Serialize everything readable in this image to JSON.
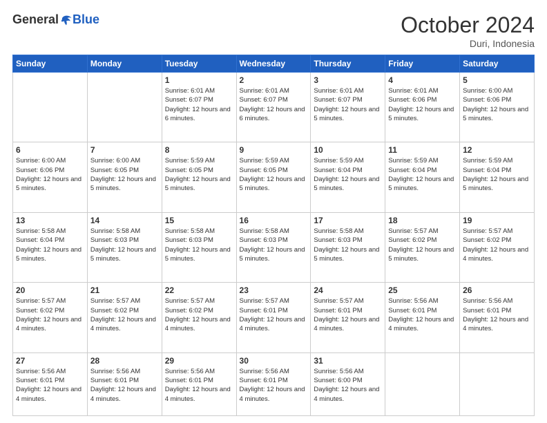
{
  "logo": {
    "general": "General",
    "blue": "Blue"
  },
  "header": {
    "month": "October 2024",
    "location": "Duri, Indonesia"
  },
  "weekdays": [
    "Sunday",
    "Monday",
    "Tuesday",
    "Wednesday",
    "Thursday",
    "Friday",
    "Saturday"
  ],
  "weeks": [
    [
      {
        "day": "",
        "info": ""
      },
      {
        "day": "",
        "info": ""
      },
      {
        "day": "1",
        "info": "Sunrise: 6:01 AM\nSunset: 6:07 PM\nDaylight: 12 hours and 6 minutes."
      },
      {
        "day": "2",
        "info": "Sunrise: 6:01 AM\nSunset: 6:07 PM\nDaylight: 12 hours and 6 minutes."
      },
      {
        "day": "3",
        "info": "Sunrise: 6:01 AM\nSunset: 6:07 PM\nDaylight: 12 hours and 5 minutes."
      },
      {
        "day": "4",
        "info": "Sunrise: 6:01 AM\nSunset: 6:06 PM\nDaylight: 12 hours and 5 minutes."
      },
      {
        "day": "5",
        "info": "Sunrise: 6:00 AM\nSunset: 6:06 PM\nDaylight: 12 hours and 5 minutes."
      }
    ],
    [
      {
        "day": "6",
        "info": "Sunrise: 6:00 AM\nSunset: 6:06 PM\nDaylight: 12 hours and 5 minutes."
      },
      {
        "day": "7",
        "info": "Sunrise: 6:00 AM\nSunset: 6:05 PM\nDaylight: 12 hours and 5 minutes."
      },
      {
        "day": "8",
        "info": "Sunrise: 5:59 AM\nSunset: 6:05 PM\nDaylight: 12 hours and 5 minutes."
      },
      {
        "day": "9",
        "info": "Sunrise: 5:59 AM\nSunset: 6:05 PM\nDaylight: 12 hours and 5 minutes."
      },
      {
        "day": "10",
        "info": "Sunrise: 5:59 AM\nSunset: 6:04 PM\nDaylight: 12 hours and 5 minutes."
      },
      {
        "day": "11",
        "info": "Sunrise: 5:59 AM\nSunset: 6:04 PM\nDaylight: 12 hours and 5 minutes."
      },
      {
        "day": "12",
        "info": "Sunrise: 5:59 AM\nSunset: 6:04 PM\nDaylight: 12 hours and 5 minutes."
      }
    ],
    [
      {
        "day": "13",
        "info": "Sunrise: 5:58 AM\nSunset: 6:04 PM\nDaylight: 12 hours and 5 minutes."
      },
      {
        "day": "14",
        "info": "Sunrise: 5:58 AM\nSunset: 6:03 PM\nDaylight: 12 hours and 5 minutes."
      },
      {
        "day": "15",
        "info": "Sunrise: 5:58 AM\nSunset: 6:03 PM\nDaylight: 12 hours and 5 minutes."
      },
      {
        "day": "16",
        "info": "Sunrise: 5:58 AM\nSunset: 6:03 PM\nDaylight: 12 hours and 5 minutes."
      },
      {
        "day": "17",
        "info": "Sunrise: 5:58 AM\nSunset: 6:03 PM\nDaylight: 12 hours and 5 minutes."
      },
      {
        "day": "18",
        "info": "Sunrise: 5:57 AM\nSunset: 6:02 PM\nDaylight: 12 hours and 5 minutes."
      },
      {
        "day": "19",
        "info": "Sunrise: 5:57 AM\nSunset: 6:02 PM\nDaylight: 12 hours and 4 minutes."
      }
    ],
    [
      {
        "day": "20",
        "info": "Sunrise: 5:57 AM\nSunset: 6:02 PM\nDaylight: 12 hours and 4 minutes."
      },
      {
        "day": "21",
        "info": "Sunrise: 5:57 AM\nSunset: 6:02 PM\nDaylight: 12 hours and 4 minutes."
      },
      {
        "day": "22",
        "info": "Sunrise: 5:57 AM\nSunset: 6:02 PM\nDaylight: 12 hours and 4 minutes."
      },
      {
        "day": "23",
        "info": "Sunrise: 5:57 AM\nSunset: 6:01 PM\nDaylight: 12 hours and 4 minutes."
      },
      {
        "day": "24",
        "info": "Sunrise: 5:57 AM\nSunset: 6:01 PM\nDaylight: 12 hours and 4 minutes."
      },
      {
        "day": "25",
        "info": "Sunrise: 5:56 AM\nSunset: 6:01 PM\nDaylight: 12 hours and 4 minutes."
      },
      {
        "day": "26",
        "info": "Sunrise: 5:56 AM\nSunset: 6:01 PM\nDaylight: 12 hours and 4 minutes."
      }
    ],
    [
      {
        "day": "27",
        "info": "Sunrise: 5:56 AM\nSunset: 6:01 PM\nDaylight: 12 hours and 4 minutes."
      },
      {
        "day": "28",
        "info": "Sunrise: 5:56 AM\nSunset: 6:01 PM\nDaylight: 12 hours and 4 minutes."
      },
      {
        "day": "29",
        "info": "Sunrise: 5:56 AM\nSunset: 6:01 PM\nDaylight: 12 hours and 4 minutes."
      },
      {
        "day": "30",
        "info": "Sunrise: 5:56 AM\nSunset: 6:01 PM\nDaylight: 12 hours and 4 minutes."
      },
      {
        "day": "31",
        "info": "Sunrise: 5:56 AM\nSunset: 6:00 PM\nDaylight: 12 hours and 4 minutes."
      },
      {
        "day": "",
        "info": ""
      },
      {
        "day": "",
        "info": ""
      }
    ]
  ]
}
